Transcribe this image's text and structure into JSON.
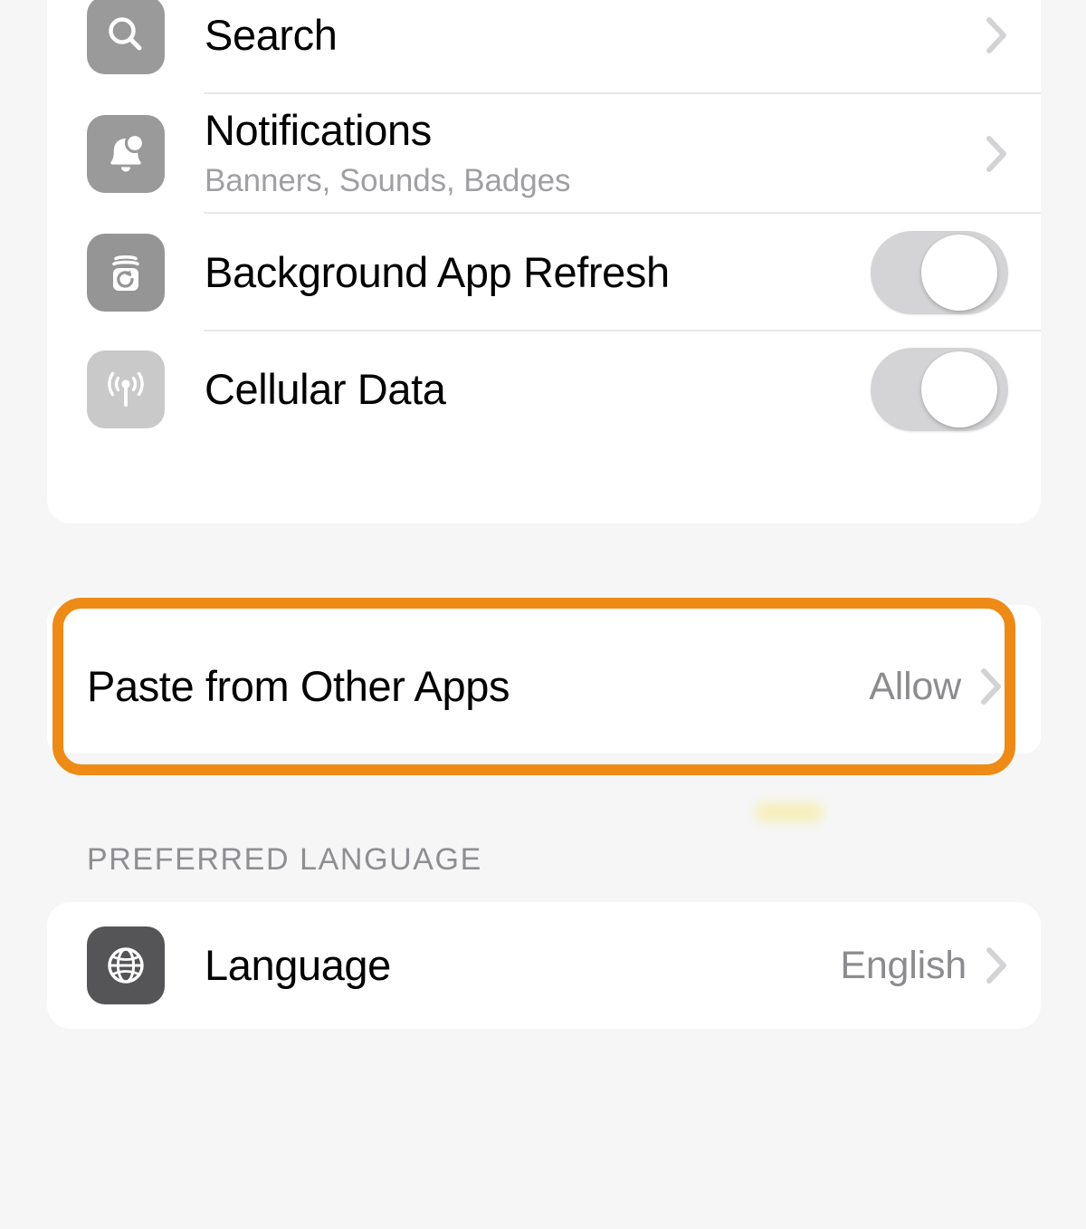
{
  "colors": {
    "page_background": "#f6f6f7",
    "card_background": "#ffffff",
    "highlight_orange": "#ed8b16",
    "separator": "#e9e9ea",
    "secondary_text": "#8c8c90",
    "subtitle_text": "#a0a0a4",
    "toggle_off_track": "#d4d4d6",
    "highlight_smudge": "#f6eeb1"
  },
  "sections": {
    "app_settings": {
      "rows": [
        {
          "label": "Search",
          "icon": "search-icon",
          "icon_style": "tile-gray",
          "accessory": "chevron"
        },
        {
          "label": "Notifications",
          "subtitle": "Banners, Sounds, Badges",
          "icon": "bell-icon",
          "icon_style": "tile-gray2",
          "accessory": "chevron"
        },
        {
          "label": "Background App Refresh",
          "icon": "background-app-refresh-icon",
          "icon_style": "tile-gray3",
          "accessory": "toggle",
          "toggle_state": "off"
        },
        {
          "label": "Cellular Data",
          "icon": "cellular-antenna-icon",
          "icon_style": "tile-light",
          "accessory": "toggle",
          "toggle_state": "off"
        }
      ]
    },
    "paste": {
      "label": "Paste from Other Apps",
      "value": "Allow",
      "accessory": "chevron",
      "highlighted": true
    },
    "preferred_language": {
      "header": "PREFERRED LANGUAGE",
      "rows": [
        {
          "label": "Language",
          "value": "English",
          "icon": "globe-icon",
          "icon_style": "tile-dark",
          "accessory": "chevron"
        }
      ]
    }
  }
}
